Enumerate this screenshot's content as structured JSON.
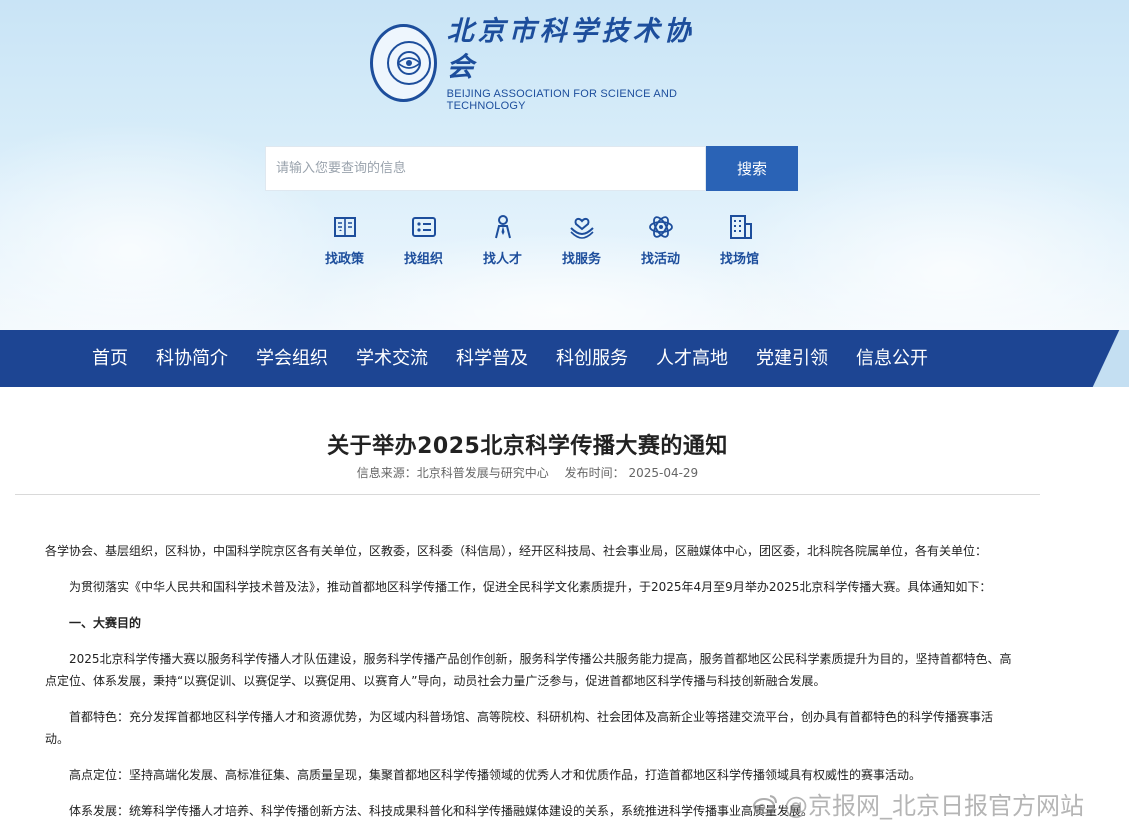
{
  "header": {
    "logo_cn": "北京市科学技术协会",
    "logo_en": "BEIJING ASSOCIATION FOR SCIENCE AND TECHNOLOGY"
  },
  "search": {
    "placeholder": "请输入您要查询的信息",
    "button_label": "搜索"
  },
  "quick_links": [
    {
      "label": "找政策",
      "icon": "policy-book-icon"
    },
    {
      "label": "找组织",
      "icon": "organization-card-icon"
    },
    {
      "label": "找人才",
      "icon": "talent-person-icon"
    },
    {
      "label": "找服务",
      "icon": "service-hands-icon"
    },
    {
      "label": "找活动",
      "icon": "activity-atom-icon"
    },
    {
      "label": "找场馆",
      "icon": "venue-building-icon"
    }
  ],
  "nav": {
    "items": [
      "首页",
      "科协简介",
      "学会组织",
      "学术交流",
      "科学普及",
      "科创服务",
      "人才高地",
      "党建引领",
      "信息公开"
    ]
  },
  "article": {
    "title": "关于举办2025北京科学传播大赛的通知",
    "source_label": "信息来源：北京科普发展与研究中心",
    "date_label": "发布时间： 2025-04-29",
    "paragraphs": [
      "各学协会、基层组织，区科协，中国科学院京区各有关单位，区教委，区科委（科信局），经开区科技局、社会事业局，区融媒体中心，团区委，北科院各院属单位，各有关单位：",
      "为贯彻落实《中华人民共和国科学技术普及法》，推动首都地区科学传播工作，促进全民科学文化素质提升，于2025年4月至9月举办2025北京科学传播大赛。具体通知如下：",
      "一、大赛目的",
      "2025北京科学传播大赛以服务科学传播人才队伍建设，服务科学传播产品创作创新，服务科学传播公共服务能力提高，服务首都地区公民科学素质提升为目的，坚持首都特色、高点定位、体系发展，秉持“以赛促训、以赛促学、以赛促用、以赛育人”导向，动员社会力量广泛参与，促进首都地区科学传播与科技创新融合发展。",
      "首都特色：充分发挥首都地区科学传播人才和资源优势，为区域内科普场馆、高等院校、科研机构、社会团体及高新企业等搭建交流平台，创办具有首都特色的科学传播赛事活动。",
      "高点定位：坚持高端化发展、高标准征集、高质量呈现，集聚首都地区科学传播领域的优秀人才和优质作品，打造首都地区科学传播领域具有权威性的赛事活动。",
      "体系发展：统筹科学传播人才培养、科学传播创新方法、科技成果科普化和科学传播融媒体建设的关系，系统推进科学传播事业高质量发展。"
    ]
  },
  "watermark": "@京报网_北京日报官方网站",
  "colors": {
    "brand_blue": "#1d4593",
    "button_blue": "#2a63b6",
    "logo_blue": "#1d4e9c"
  }
}
